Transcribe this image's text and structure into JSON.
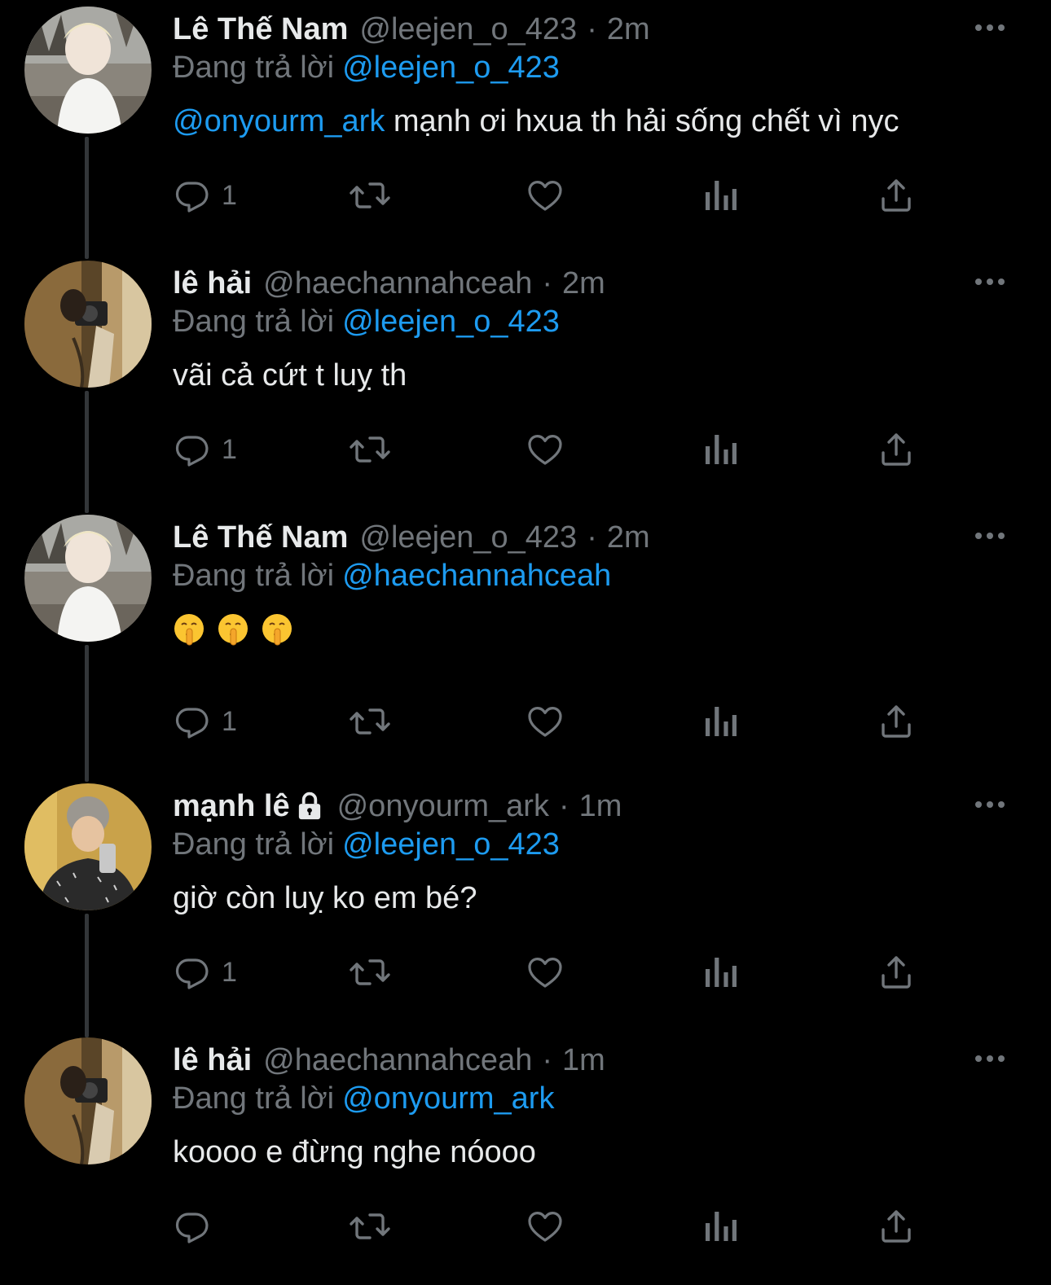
{
  "theme": {
    "background": "#000000",
    "text": "#e7e9ea",
    "muted": "#71767b",
    "accent": "#1d9bf0",
    "thread_line": "#333639"
  },
  "reply_prefix": "Đang trả lời",
  "tweets": [
    {
      "display_name": "Lê Thế Nam",
      "handle": "@leejen_o_423",
      "separator": "·",
      "time": "2m",
      "replying_to": "@leejen_o_423",
      "body_mention": "@onyourm_ark",
      "body_text": " mạnh ơi hxua th hải sống chết vì nyc",
      "reply_count": "1",
      "avatar": "light-hair-boy-avatar"
    },
    {
      "display_name": "lê hải",
      "handle": "@haechannahceah",
      "separator": "·",
      "time": "2m",
      "replying_to": "@leejen_o_423",
      "body_mention": "",
      "body_text": "vãi cả cứt t luỵ th",
      "reply_count": "1",
      "avatar": "mirror-selfie-avatar"
    },
    {
      "display_name": "Lê Thế Nam",
      "handle": "@leejen_o_423",
      "separator": "·",
      "time": "2m",
      "replying_to": "@haechannahceah",
      "body_mention": "",
      "body_text": "",
      "emojis": [
        "🤫",
        "🤫",
        "🤫"
      ],
      "reply_count": "1",
      "avatar": "light-hair-boy-avatar"
    },
    {
      "display_name": "mạnh lê",
      "handle": "@onyourm_ark",
      "separator": "·",
      "time": "1m",
      "replying_to": "@leejen_o_423",
      "body_mention": "",
      "body_text": "giờ còn luỵ ko em bé?",
      "reply_count": "1",
      "protected": true,
      "avatar": "beanie-selfie-avatar"
    },
    {
      "display_name": "lê hải",
      "handle": "@haechannahceah",
      "separator": "·",
      "time": "1m",
      "replying_to": "@onyourm_ark",
      "body_mention": "",
      "body_text": "koooo e đừng nghe nóooo",
      "reply_count": "",
      "avatar": "mirror-selfie-avatar"
    }
  ],
  "icons": {
    "reply": "reply-icon",
    "retweet": "retweet-icon",
    "like": "like-icon",
    "views": "views-icon",
    "share": "share-icon",
    "more": "more-icon",
    "lock": "lock-icon"
  }
}
